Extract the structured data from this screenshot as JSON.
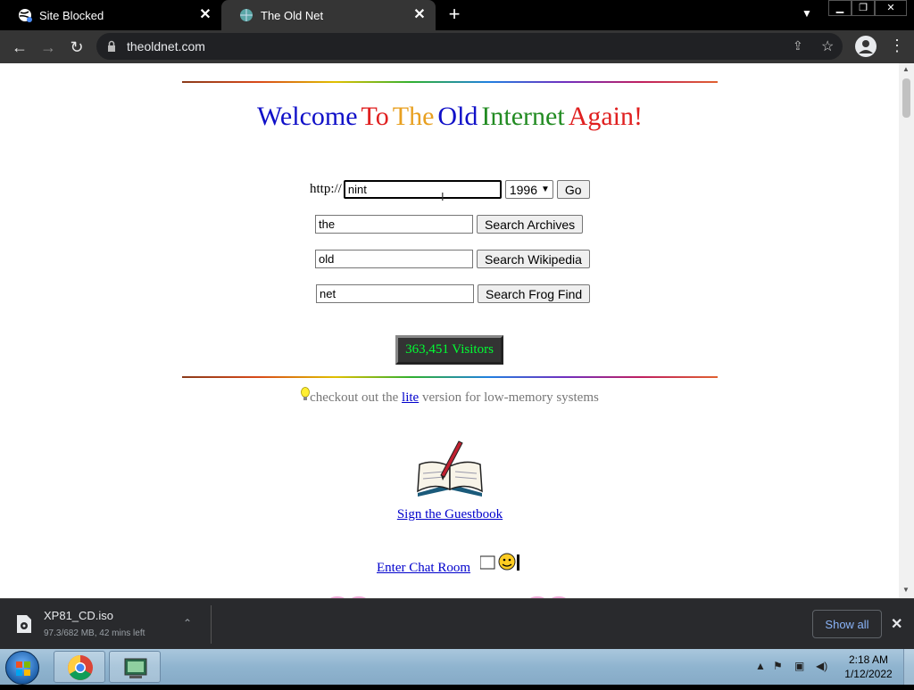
{
  "browser": {
    "tabs": [
      {
        "title": "Site Blocked",
        "active": false
      },
      {
        "title": "The Old Net",
        "active": true
      }
    ],
    "url": "theoldnet.com"
  },
  "page": {
    "headline_words": [
      "Welcome",
      "To",
      "The",
      "Old",
      "Internet",
      "Again!"
    ],
    "headline_colors": [
      "#1010c8",
      "#e02020",
      "#e8a020",
      "#1010c8",
      "#228b22",
      "#e02020"
    ],
    "url_prefix": "http://",
    "url_value": "nint",
    "year_selected": "1996",
    "go_label": "Go",
    "archives_value": "the",
    "archives_button": "Search Archives",
    "wikipedia_value": "old",
    "wikipedia_button": "Search Wikipedia",
    "frogfind_value": "net",
    "frogfind_button": "Search Frog Find",
    "visitor_counter": "363,451 Visitors",
    "lite_prefix": "checkout out the",
    "lite_link": "lite",
    "lite_suffix": "version for low-memory systems",
    "guestbook_link": "Sign the Guestbook",
    "chat_link": "Enter Chat Room"
  },
  "download": {
    "filename": "XP81_CD.iso",
    "status": "97.3/682 MB, 42 mins left",
    "show_all": "Show all"
  },
  "taskbar": {
    "time": "2:18 AM",
    "date": "1/12/2022"
  }
}
